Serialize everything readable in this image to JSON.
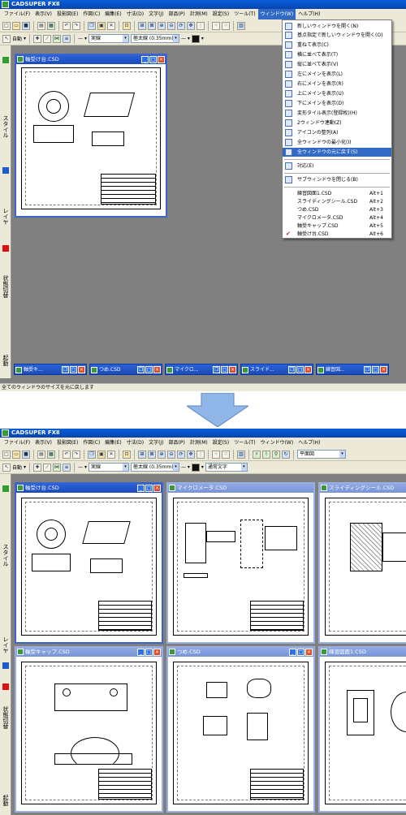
{
  "app_title": "CADSUPER FXⅡ",
  "menu": [
    "ファイル(F)",
    "表示(V)",
    "投影図(E)",
    "作図(C)",
    "編集(E)",
    "寸法(D)",
    "文字(J)",
    "部品(P)",
    "計測(M)",
    "設定(S)",
    "ツール(T)",
    "ウィンドウ(W)",
    "ヘルプ(H)"
  ],
  "toolbar": {
    "auto_label": "自動",
    "linetype": "実線",
    "linewidth": "極太線 (0.35mm) 3",
    "textstyle": "通常文字",
    "view": "平面図"
  },
  "sidebar_tabs": [
    "スタイル",
    "レイヤ",
    "状態切替",
    "起動"
  ],
  "window_menu": {
    "items": [
      {
        "label": "新しいウィンドウを開く(N)"
      },
      {
        "label": "基点指定で新しいウィンドウを開く(O)"
      },
      {
        "label": "重ねて表示(C)"
      },
      {
        "label": "横に並べて表示(T)"
      },
      {
        "label": "縦に並べて表示(V)"
      },
      {
        "label": "左にメインを表示(L)"
      },
      {
        "label": "右にメインを表示(R)"
      },
      {
        "label": "上にメインを表示(U)"
      },
      {
        "label": "下にメインを表示(D)"
      },
      {
        "label": "変形タイル表示(登録枚)(H)"
      },
      {
        "label": "2ウィンドウ連動(Z)"
      },
      {
        "label": "アイコンの整列(A)"
      },
      {
        "label": "全ウィンドウの最小化(I)"
      },
      {
        "label": "全ウィンドウの元に戻す(S)"
      },
      {
        "label": "対応(E)"
      },
      {
        "label": "サブウィンドウを閉じる(B)"
      }
    ],
    "documents": [
      {
        "label": "練習図面1.CSD",
        "accel": "Alt+1"
      },
      {
        "label": "スライディングシール.CSD",
        "accel": "Alt+2"
      },
      {
        "label": "つめ.CSD",
        "accel": "Alt+3"
      },
      {
        "label": "マイクロメータ.CSD",
        "accel": "Alt+4"
      },
      {
        "label": "軸受キャップ.CSD",
        "accel": "Alt+5"
      },
      {
        "label": "軸受け台.CSD",
        "accel": "Alt+6"
      }
    ]
  },
  "before": {
    "active_window": "軸受け台.CSD",
    "minimized": [
      "軸受キ...",
      "つめ.CSD",
      "マイクロ...",
      "スライド...",
      "練習図..."
    ],
    "status": "全てのウィンドウのサイズを元に戻します"
  },
  "after": {
    "windows": [
      "軸受け台.CSD",
      "マイクロメータ.CSD",
      "スライディングシール.CSD",
      "軸受キャップ.CSD",
      "つめ.CSD",
      "練習図面1.CSD"
    ]
  },
  "colors": {
    "title": "#0a5fd8",
    "highlight": "#316ac5",
    "arrow": "#8fb6e6",
    "mdi": "#808080"
  }
}
